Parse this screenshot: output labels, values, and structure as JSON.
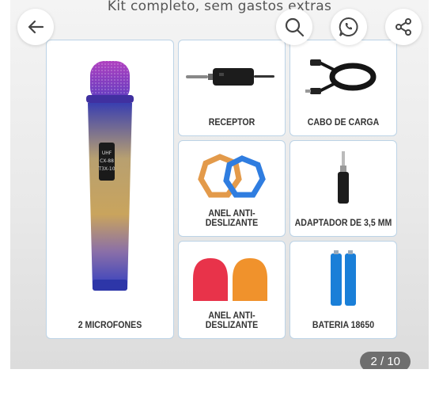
{
  "banner": {
    "title": "Kit completo, sem gastos extras"
  },
  "toolbar": {
    "back_icon": "arrow-left-icon",
    "search_icon": "search-icon",
    "whatsapp_icon": "whatsapp-icon",
    "share_icon": "share-icon"
  },
  "items": [
    {
      "label": "2 MICROFONES",
      "icon": "microphone"
    },
    {
      "label": "RECEPTOR",
      "icon": "receiver"
    },
    {
      "label": "CABO DE CARGA",
      "icon": "charging-cable"
    },
    {
      "label": "ANEL ANTI-DESLIZANTE",
      "icon": "anti-slip-rings"
    },
    {
      "label": "ADAPTADOR DE 3,5 MM",
      "icon": "audio-adapter"
    },
    {
      "label": "ANEL ANTI-DESLIZANTE",
      "icon": "foam-covers"
    },
    {
      "label": "BATERIA 18650",
      "icon": "batteries"
    }
  ],
  "mic_screen": {
    "line1": "UHF",
    "line2": "CX-88",
    "line3": "T3X-10"
  },
  "pager": {
    "text": "2 / 10"
  },
  "colors": {
    "card_border": "#bcd3e6",
    "counter_bg": "#5a5a5a"
  }
}
